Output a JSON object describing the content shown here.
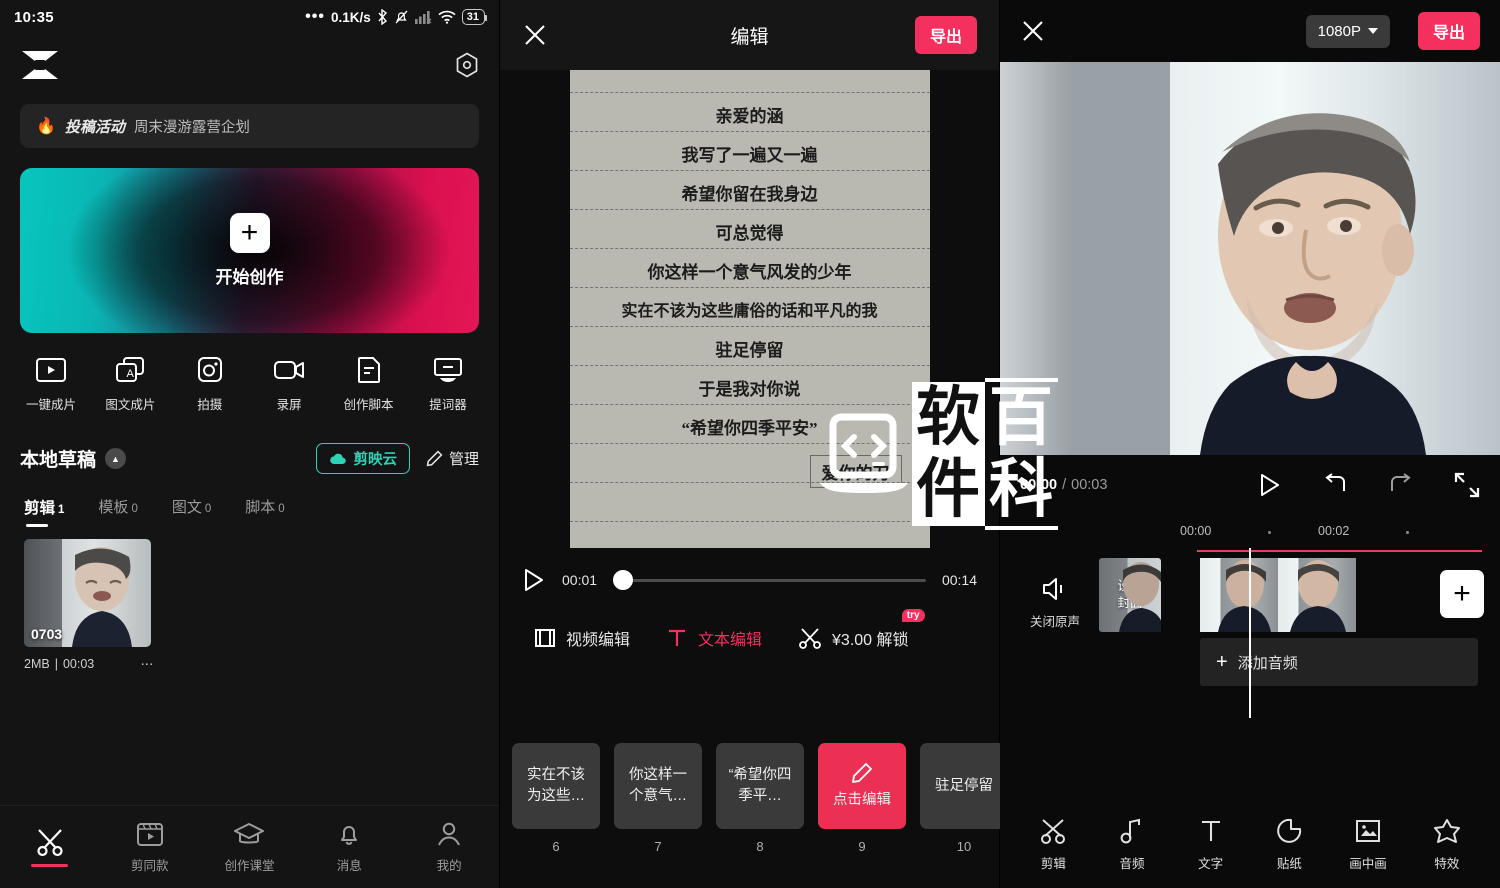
{
  "status_bar": {
    "time": "10:35",
    "net_speed": "0.1K/s",
    "battery_level": "31",
    "icons": [
      "dots-icon",
      "bluetooth-icon",
      "bell-muted-icon",
      "signal-icon",
      "wifi-icon",
      "battery-icon"
    ]
  },
  "home": {
    "logo_name": "capcut-logo-icon",
    "settings_icon": "gear-icon",
    "banner": {
      "fire_icon": "fire-icon",
      "tag": "投稿活动",
      "text": "周末漫游露营企划"
    },
    "create_card": {
      "plus_icon": "plus-icon",
      "label": "开始创作",
      "gradient_from": "#07c6bd",
      "gradient_to": "#e51656"
    },
    "tools": [
      {
        "icon": "one-click-film-icon",
        "label": "一键成片"
      },
      {
        "icon": "image-text-film-icon",
        "label": "图文成片"
      },
      {
        "icon": "camera-icon",
        "label": "拍摄"
      },
      {
        "icon": "screen-record-icon",
        "label": "录屏"
      },
      {
        "icon": "script-icon",
        "label": "创作脚本"
      },
      {
        "icon": "teleprompter-icon",
        "label": "提词器"
      }
    ],
    "drafts": {
      "title": "本地草稿",
      "collapse_icon": "chevron-up-icon",
      "cloud_button": {
        "icon": "cloud-icon",
        "label": "剪映云",
        "color": "#2ed3b7"
      },
      "manage_button": {
        "icon": "pencil-icon",
        "label": "管理"
      },
      "tabs": [
        {
          "label": "剪辑",
          "count": "1",
          "active": true
        },
        {
          "label": "模板",
          "count": "0",
          "active": false
        },
        {
          "label": "图文",
          "count": "0",
          "active": false
        },
        {
          "label": "脚本",
          "count": "0",
          "active": false
        }
      ],
      "items": [
        {
          "name": "0703",
          "size": "2MB",
          "separator": "|",
          "duration": "00:03",
          "more_icon": "more-vertical-icon"
        }
      ]
    },
    "bottom_nav": [
      {
        "icon": "scissors-icon",
        "label": "",
        "active": true
      },
      {
        "icon": "clapboard-icon",
        "label": "剪同款",
        "active": false
      },
      {
        "icon": "graduation-cap-icon",
        "label": "创作课堂",
        "active": false
      },
      {
        "icon": "bell-icon",
        "label": "消息",
        "active": false
      },
      {
        "icon": "person-icon",
        "label": "我的",
        "active": false
      }
    ],
    "accent_color": "#f3305e"
  },
  "edit_panel": {
    "close_icon": "close-icon",
    "title": "编辑",
    "export_label": "导出",
    "letter": {
      "lines": [
        "亲爱的涵",
        "我写了一遍又一遍",
        "希望你留在我身边",
        "可总觉得",
        "你这样一个意气风发的少年",
        "实在不该为这些庸俗的话和平凡的我",
        "驻足停留",
        "于是我对你说",
        "“希望你四季平安”"
      ],
      "signature": "爱你的刀"
    },
    "watermark": {
      "icon": "code-laptop-icon",
      "text_a": "软件",
      "text_b": "百科"
    },
    "player": {
      "play_icon": "play-icon",
      "current": "00:01",
      "total": "00:14",
      "progress_percent": 2
    },
    "modes": [
      {
        "icon": "film-icon",
        "label": "视频编辑",
        "active": false
      },
      {
        "icon": "text-T-icon",
        "label": "文本编辑",
        "active": true
      },
      {
        "icon": "scissors-icon",
        "label": "¥3.00 解锁",
        "active": false,
        "badge": "try"
      }
    ],
    "text_cards": [
      {
        "text": "实在不该为这些…",
        "index": "6",
        "selected": false
      },
      {
        "text": "你这样一个意气…",
        "index": "7",
        "selected": false
      },
      {
        "text": "“希望你四季平…",
        "index": "8",
        "selected": false
      },
      {
        "text": "点击编辑",
        "index": "9",
        "selected": true,
        "icon": "pencil-icon"
      },
      {
        "text": "驻足停留",
        "index": "10",
        "selected": false
      }
    ]
  },
  "timeline_panel": {
    "close_icon": "close-icon",
    "resolution": "1080P",
    "resolution_caret": "chevron-down-icon",
    "export_label": "导出",
    "player": {
      "current": "00:00",
      "separator": "/",
      "total": "00:03",
      "play_icon": "play-icon",
      "undo_icon": "undo-icon",
      "redo_icon": "redo-icon",
      "fullscreen_icon": "fullscreen-icon"
    },
    "ruler_ticks": [
      "00:00",
      "00:02"
    ],
    "track": {
      "mute_icon": "speaker-mute-icon",
      "mute_label": "关闭原声",
      "cover_label": "设置\n封面",
      "cover_label_line1": "设置",
      "cover_label_line2": "封面",
      "add_clip_icon": "plus-icon",
      "add_audio_icon": "plus-icon",
      "add_audio_label": "添加音频"
    },
    "tools": [
      {
        "icon": "scissors-icon",
        "label": "剪辑"
      },
      {
        "icon": "music-note-icon",
        "label": "音频"
      },
      {
        "icon": "text-T-icon",
        "label": "文字"
      },
      {
        "icon": "sticker-icon",
        "label": "贴纸"
      },
      {
        "icon": "picture-in-picture-icon",
        "label": "画中画"
      },
      {
        "icon": "effects-star-icon",
        "label": "特效"
      }
    ]
  }
}
